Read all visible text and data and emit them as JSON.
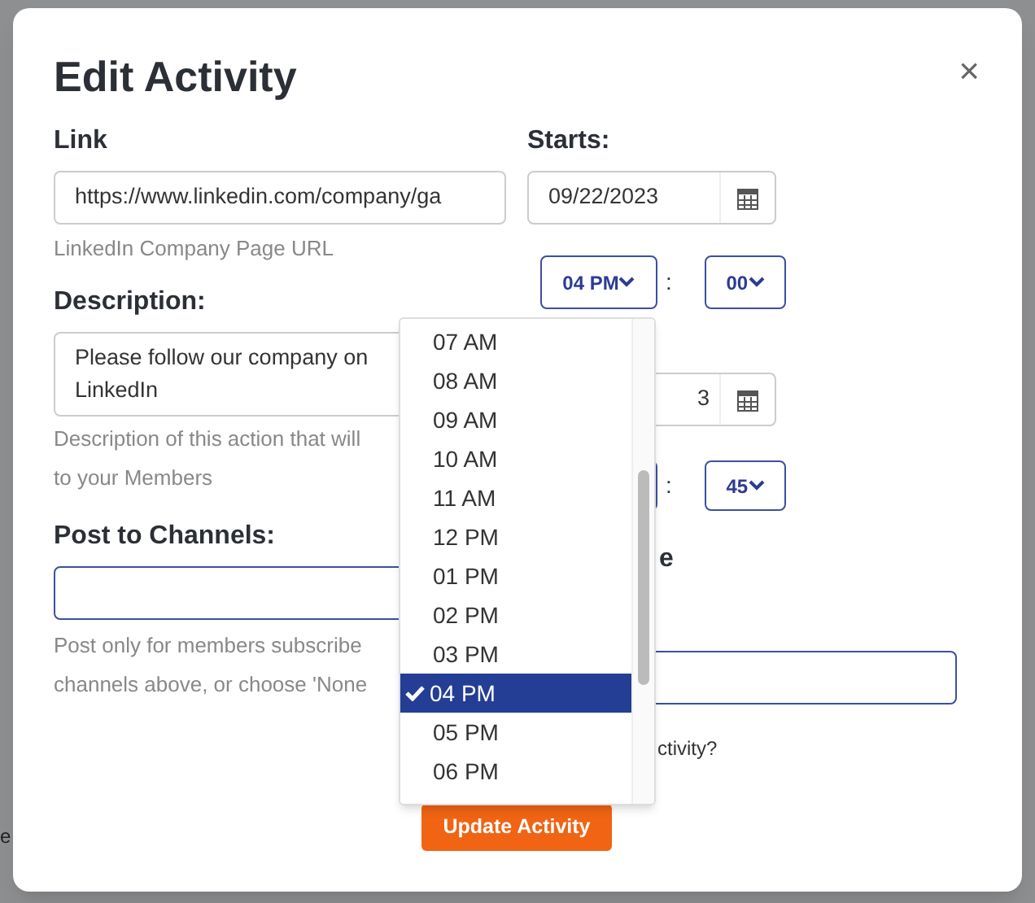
{
  "backdrop": {
    "texts": [
      "e"
    ]
  },
  "dialog": {
    "title": "Edit Activity",
    "close": "×"
  },
  "link": {
    "label": "Link",
    "value": "https://www.linkedin.com/company/ga",
    "help": "LinkedIn Company Page URL"
  },
  "description": {
    "label": "Description:",
    "value_lines": [
      "Please follow our company on",
      "LinkedIn"
    ],
    "help_lines": [
      "Description of this action that will",
      "to your Members"
    ]
  },
  "channels": {
    "label": "Post to Channels:",
    "help_lines": [
      "Post only for members subscribe",
      "channels above, or choose 'None"
    ]
  },
  "starts": {
    "label": "Starts:",
    "date": "09/22/2023",
    "hour": "04 PM",
    "separator": ":",
    "minute": "00"
  },
  "ends": {
    "date": "3",
    "separator": ":",
    "minute": "45"
  },
  "zone": {
    "label": "e"
  },
  "question": "ctivity?",
  "hour_menu": {
    "items": [
      {
        "label": "07 AM",
        "selected": false
      },
      {
        "label": "08 AM",
        "selected": false
      },
      {
        "label": "09 AM",
        "selected": false
      },
      {
        "label": "10 AM",
        "selected": false
      },
      {
        "label": "11 AM",
        "selected": false
      },
      {
        "label": "12 PM",
        "selected": false
      },
      {
        "label": "01 PM",
        "selected": false
      },
      {
        "label": "02 PM",
        "selected": false
      },
      {
        "label": "03 PM",
        "selected": false
      },
      {
        "label": "04 PM",
        "selected": true
      },
      {
        "label": "05 PM",
        "selected": false
      },
      {
        "label": "06 PM",
        "selected": false
      }
    ]
  },
  "submit": "Update Activity"
}
